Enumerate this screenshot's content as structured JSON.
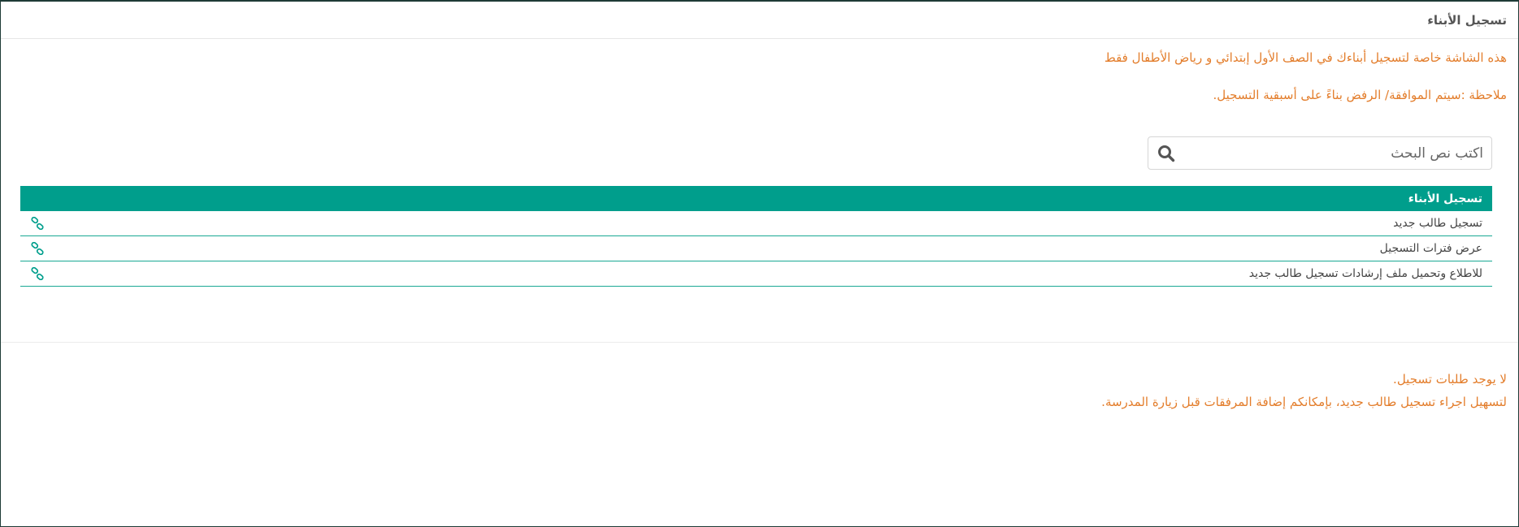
{
  "panel": {
    "title": "تسجيل الأبناء"
  },
  "notices": {
    "line1": "هذه الشاشة خاصة لتسجيل أبناءك في الصف الأول إبتدائي و رياض الأطفال فقط",
    "line2": "ملاحظة :سيتم الموافقة/ الرفض بناءً على أسبقية التسجيل."
  },
  "search": {
    "placeholder": "اكتب نص البحث",
    "value": ""
  },
  "grid": {
    "header": "تسجيل الأبناء",
    "rows": [
      {
        "label": "تسجيل طالب جديد",
        "icon": "link-icon"
      },
      {
        "label": "عرض فترات التسجيل",
        "icon": "link-icon"
      },
      {
        "label": "للاطلاع وتحميل ملف إرشادات تسجيل طالب جديد",
        "icon": "link-icon"
      }
    ]
  },
  "footer_notices": {
    "line1": "لا يوجد طلبات تسجيل.",
    "line2": "لتسهيل اجراء تسجيل طالب جديد، بإمكانكم إضافة المرفقات قبل زيارة المدرسة."
  },
  "colors": {
    "accent": "#009e8c",
    "notice": "#e37d2b",
    "border": "#1e3b36"
  }
}
